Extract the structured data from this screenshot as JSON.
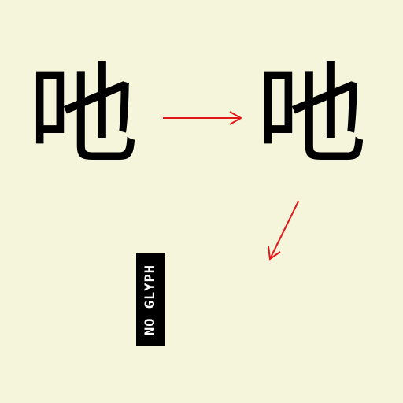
{
  "background_color": "#f5f5dc",
  "arrow_color": "#e01818",
  "glyph_source": "吔",
  "glyph_target": "吔",
  "no_glyph_label": "NO GLYPH"
}
